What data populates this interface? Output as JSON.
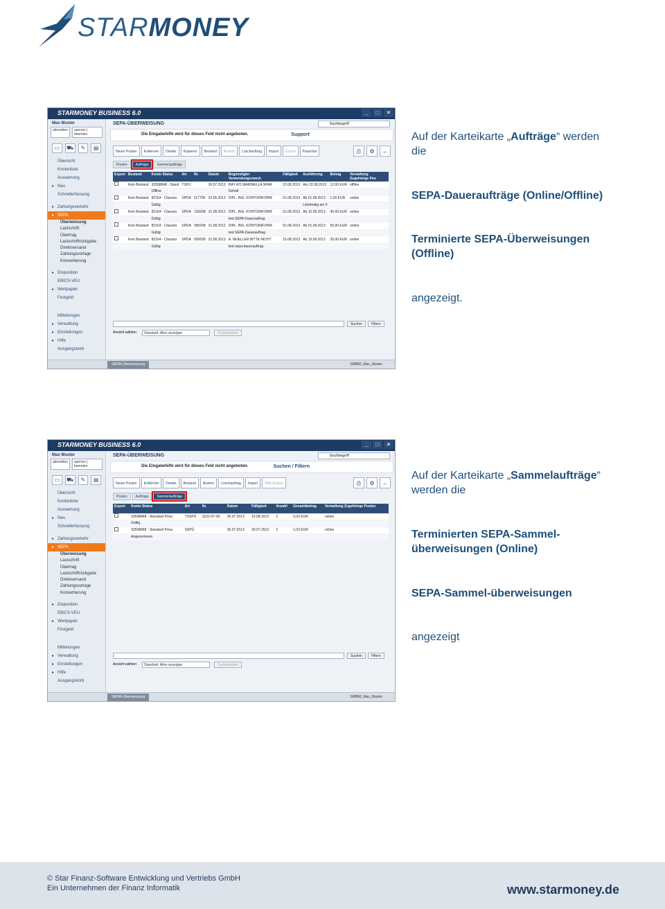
{
  "brand": {
    "logo_text_a": "STAR",
    "logo_text_b": "MONEY"
  },
  "shots": [
    {
      "app_title": "STARMONEY BUSINESS 6.0",
      "user": "Max Muster",
      "user_buttons": [
        "abmelden",
        "sperren | beenden"
      ],
      "nav": [
        {
          "label": "Übersicht",
          "kind": "top"
        },
        {
          "label": "Kontenliste",
          "kind": "top"
        },
        {
          "label": "Auswertung",
          "kind": "top"
        },
        {
          "label": "Neu",
          "kind": "arrow"
        },
        {
          "label": "Schnellerfassung",
          "kind": "top"
        },
        {
          "label": "Zahlungsverkehr",
          "kind": "arrow"
        },
        {
          "label": "SEPA",
          "kind": "sel"
        },
        {
          "label": "Überweisung",
          "kind": "subb"
        },
        {
          "label": "Lastschrift",
          "kind": "sub"
        },
        {
          "label": "Übertrag",
          "kind": "sub"
        },
        {
          "label": "Lastschriftrückgabe",
          "kind": "sub"
        },
        {
          "label": "Direktversand",
          "kind": "sub"
        },
        {
          "label": "Zahlungsvorlage",
          "kind": "sub"
        },
        {
          "label": "Konvertierung",
          "kind": "sub"
        },
        {
          "label": "Disposition",
          "kind": "arrow"
        },
        {
          "label": "EBICS-VEU",
          "kind": "top"
        },
        {
          "label": "Wertpapier",
          "kind": "arrow"
        },
        {
          "label": "Festgeld",
          "kind": "top"
        },
        {
          "label": "Mitteilungen",
          "kind": "top"
        },
        {
          "label": "Verwaltung",
          "kind": "arrow"
        },
        {
          "label": "Einstellungen",
          "kind": "arrow"
        },
        {
          "label": "Hilfe",
          "kind": "arrow"
        },
        {
          "label": "Ausgangskorb",
          "kind": "top"
        }
      ],
      "header": "SEPA-ÜBERWEISUNG",
      "search_placeholder": "Suchbegriff",
      "help_text": "Die Eingabehilfe wird für dieses Feld nicht angeboten.",
      "help_link": "Support",
      "toolbar": [
        "Neuer Posten",
        "Entfernen",
        "Details",
        "Kopieren",
        "Bestand",
        "Ändern",
        "Löschauftrag",
        "Import",
        "Export",
        "Pauschal"
      ],
      "tabs": [
        "Posten",
        "Aufträge",
        "Sammelaufträge"
      ],
      "active_tab": 1,
      "columns": [
        "Export",
        "Bestand",
        "Konto Status",
        "Art",
        "Nr.",
        "Datum",
        "Begünstigter Verwendungszweck",
        "Fälligkeit",
        "Ausführung",
        "Betrag",
        "Verwaltung Zugehörige Pos"
      ],
      "rows": [
        [
          "",
          "Kein Bestand",
          "32508848 - Stand",
          "TSPÜ",
          "",
          "30.07.2013",
          "INFI 421 MARINELLA SPAR",
          "22.08.2013",
          "Am 22.08.2013",
          "12,00 EUR",
          "offline"
        ],
        [
          "",
          "",
          "Offline",
          "",
          "",
          "",
          "Gehalt",
          "",
          "",
          "",
          ""
        ],
        [
          "",
          "Kein Bestand",
          "82164 - Classixx",
          "SPDA",
          "117705",
          "22.05.2013",
          "DIPL. ING. KONTOINFORM",
          "01.08.2013",
          "Ab 01.08.2013",
          "1,00 EUR",
          "online"
        ],
        [
          "",
          "",
          "Gültig",
          "",
          "",
          "",
          "",
          "",
          "Letztmalig am 0",
          "",
          ""
        ],
        [
          "",
          "Kein Bestand",
          "82164 - Classixx",
          "SPDA",
          "139208",
          "31.08.2012",
          "DIPL. ING. KONTOINFORM",
          "01.08.2013",
          "Ab 10.08.2013",
          "40,00 EUR",
          "online"
        ],
        [
          "",
          "",
          "Gültig",
          "",
          "",
          "",
          "test SEPA Dauerauftrag",
          "",
          "",
          "",
          ""
        ],
        [
          "",
          "Kein Bestand",
          "82164 - Classixx",
          "SPDA",
          "395208",
          "31.08.2012",
          "DIPL. ING. KONTOINFORM",
          "01.08.2013",
          "Ab 01.08.2013",
          "50,00 EUR",
          "online"
        ],
        [
          "",
          "",
          "Gültig",
          "",
          "",
          "",
          "test SEPA-Dauerauftrag",
          "",
          "",
          "",
          ""
        ],
        [
          "",
          "Kein Bestand",
          "82164 - Classixx",
          "SPDA",
          "926508",
          "31.08.2013",
          "A. MUELLER BITTE NICHT",
          "15.08.2013",
          "Ab 15.08.2013",
          "30,00 EUR",
          "online"
        ],
        [
          "",
          "",
          "Gültig",
          "",
          "",
          "",
          "test sepa-dauerauftrag",
          "",
          "",
          "",
          ""
        ]
      ],
      "buttons": {
        "suchen": "Suchen",
        "filtern": "Filtern",
        "ansicht_label": "Ansicht wählen:",
        "ansicht_value": "Standard: Alles anzeigen",
        "reset": "Zurücksetzen"
      },
      "status_tab": "SEPA-Überweisung",
      "status_user": "SMB60_Max_Muster"
    },
    {
      "app_title": "STARMONEY BUSINESS 6.0",
      "user": "Max Muster",
      "user_buttons": [
        "abmelden",
        "sperren | beenden"
      ],
      "header": "SEPA-ÜBERWEISUNG",
      "search_placeholder": "Suchbegriff",
      "help_text": "Die Eingabehilfe wird für dieses Feld nicht angeboten.",
      "help_link": "Suchen / Filtern",
      "toolbar": [
        "Neuer Posten",
        "Entfernen",
        "Details",
        "Bestand",
        "Ändern",
        "Löschauftrag",
        "Import",
        "XML-Export"
      ],
      "tabs": [
        "Posten",
        "Aufträge",
        "Sammelaufträge"
      ],
      "active_tab": 2,
      "columns": [
        "Export",
        "Konto Status",
        "Art",
        "Nr.",
        "Datum",
        "Fälligkeit",
        "Anzahl",
        "Gesamtbetrag",
        "Verwaltung Zugehörige Posten"
      ],
      "rows": [
        [
          "",
          "32508848 - Standard Priva",
          "TSSPÜ",
          "3222-07-30",
          "30.07.2013",
          "15.08.2013",
          "2",
          "0,02 EUR",
          "online"
        ],
        [
          "",
          "Gültig",
          "",
          "",
          "",
          "",
          "",
          "",
          ""
        ],
        [
          "",
          "32508848 - Standard Priva",
          "SSPÜ",
          "",
          "30.07.2013",
          "30.07.2013",
          "2",
          "1,03 EUR",
          "online"
        ],
        [
          "",
          "Angenommen",
          "",
          "",
          "",
          "",
          "",
          "",
          ""
        ]
      ],
      "buttons": {
        "suchen": "Suchen",
        "filtern": "Filtern",
        "ansicht_label": "Ansicht wählen:",
        "ansicht_value": "Standard: Alles anzeigen",
        "reset": "Zurücksetzen"
      },
      "status_tab": "SEPA-Überweisung",
      "status_user": "SMB60_Max_Muster"
    }
  ],
  "text1": {
    "a_pre": "Auf der Karteikarte „",
    "a_bold": "Aufträge",
    "a_post": "“ werden",
    "a_line2": "die",
    "b": "SEPA-Daueraufträge (Online/Offline)",
    "c1": "Terminierte SEPA-Überweisungen",
    "c2": "(Offline)",
    "d": "angezeigt."
  },
  "text2": {
    "a_pre": "Auf der Karteikarte „",
    "a_bold": "Sammelaufträge",
    "a_post": "“",
    "a_line2": "werden die",
    "b1": "Terminierten SEPA-Sammel-",
    "b2": "überweisungen (Online)",
    "c": "SEPA-Sammel-überweisungen",
    "d": "angezeigt"
  },
  "footer": {
    "line1": "© Star Finanz-Software Entwicklung und Vertriebs GmbH",
    "line2": "Ein Unternehmen der Finanz Informatik",
    "url": "www.starmoney.de"
  }
}
